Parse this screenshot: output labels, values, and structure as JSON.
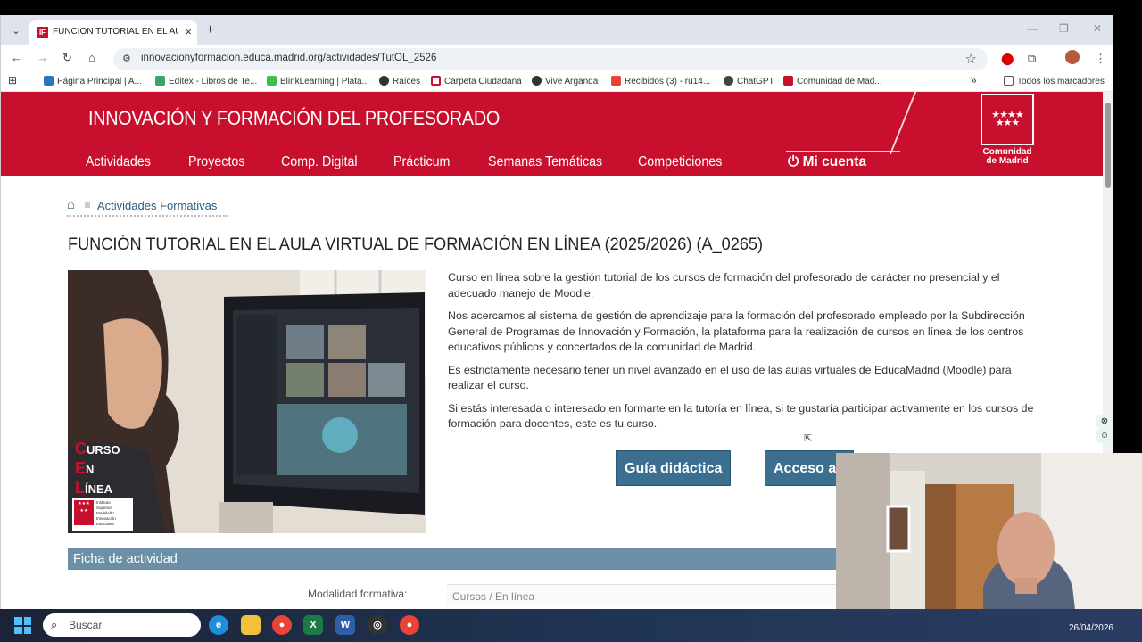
{
  "browser": {
    "tab_title": "FUNCIÓN TUTORIAL EN EL AUL",
    "url": "innovacionyformacion.educa.madrid.org/actividades/TutOL_2526",
    "bookmarks": [
      "Página Principal | A...",
      "Editex - Libros de Te...",
      "BlinkLearning | Plata...",
      "Raíces",
      "Carpeta Ciudadana",
      "Vive Arganda",
      "Recibidos (3) - ru14...",
      "ChatGPT",
      "Comunidad de Mad..."
    ],
    "all_bookmarks": "Todos los marcadores"
  },
  "site": {
    "title": "INNOVACIÓN Y FORMACIÓN DEL PROFESORADO",
    "nav": [
      "Actividades",
      "Proyectos",
      "Comp. Digital",
      "Prácticum",
      "Semanas Temáticas",
      "Competiciones"
    ],
    "account": "Mi cuenta",
    "logo_text": "Comunidad de Madrid",
    "accent": "#c8102e"
  },
  "breadcrumb": "Actividades Formativas",
  "page_title": "FUNCIÓN TUTORIAL EN EL AULA VIRTUAL DE FORMACIÓN EN LÍNEA (2025/2026) (A_0265)",
  "hero": {
    "letters": [
      "C",
      "E",
      "L"
    ],
    "words": [
      "URSO",
      "N",
      "ÍNEA"
    ],
    "institute": [
      "Instituto",
      "Superior",
      "Madrileño",
      "Innovación",
      "Educativa"
    ],
    "logo_caption": "Comunidad de Madrid"
  },
  "description": [
    "Curso en línea sobre la gestión tutorial de los cursos de formación del profesorado de carácter no presencial y el adecuado manejo de Moodle.",
    "Nos acercamos al sistema de gestión de aprendizaje para la formación del profesorado empleado por la Subdirección General de Programas de Innovación y Formación, la plataforma para la realización de cursos en línea de los centros educativos públicos y concertados de la comunidad de Madrid.",
    "Es estrictamente necesario tener un nivel avanzado en el uso de las aulas virtuales de EducaMadrid (Moodle) para realizar el curso.",
    "Si estás interesada o interesado en formarte en la tutoría en línea, si te gustaría participar activamente en los cursos de formación para docentes, este es tu curso."
  ],
  "buttons": {
    "guide": "Guía didáctica",
    "access": "Acceso al"
  },
  "ficha": {
    "heading": "Ficha de actividad",
    "label": "Modalidad formativa:",
    "value": "Cursos / En línea"
  },
  "taskbar": {
    "search": "Buscar",
    "date": "26/04/2026"
  }
}
